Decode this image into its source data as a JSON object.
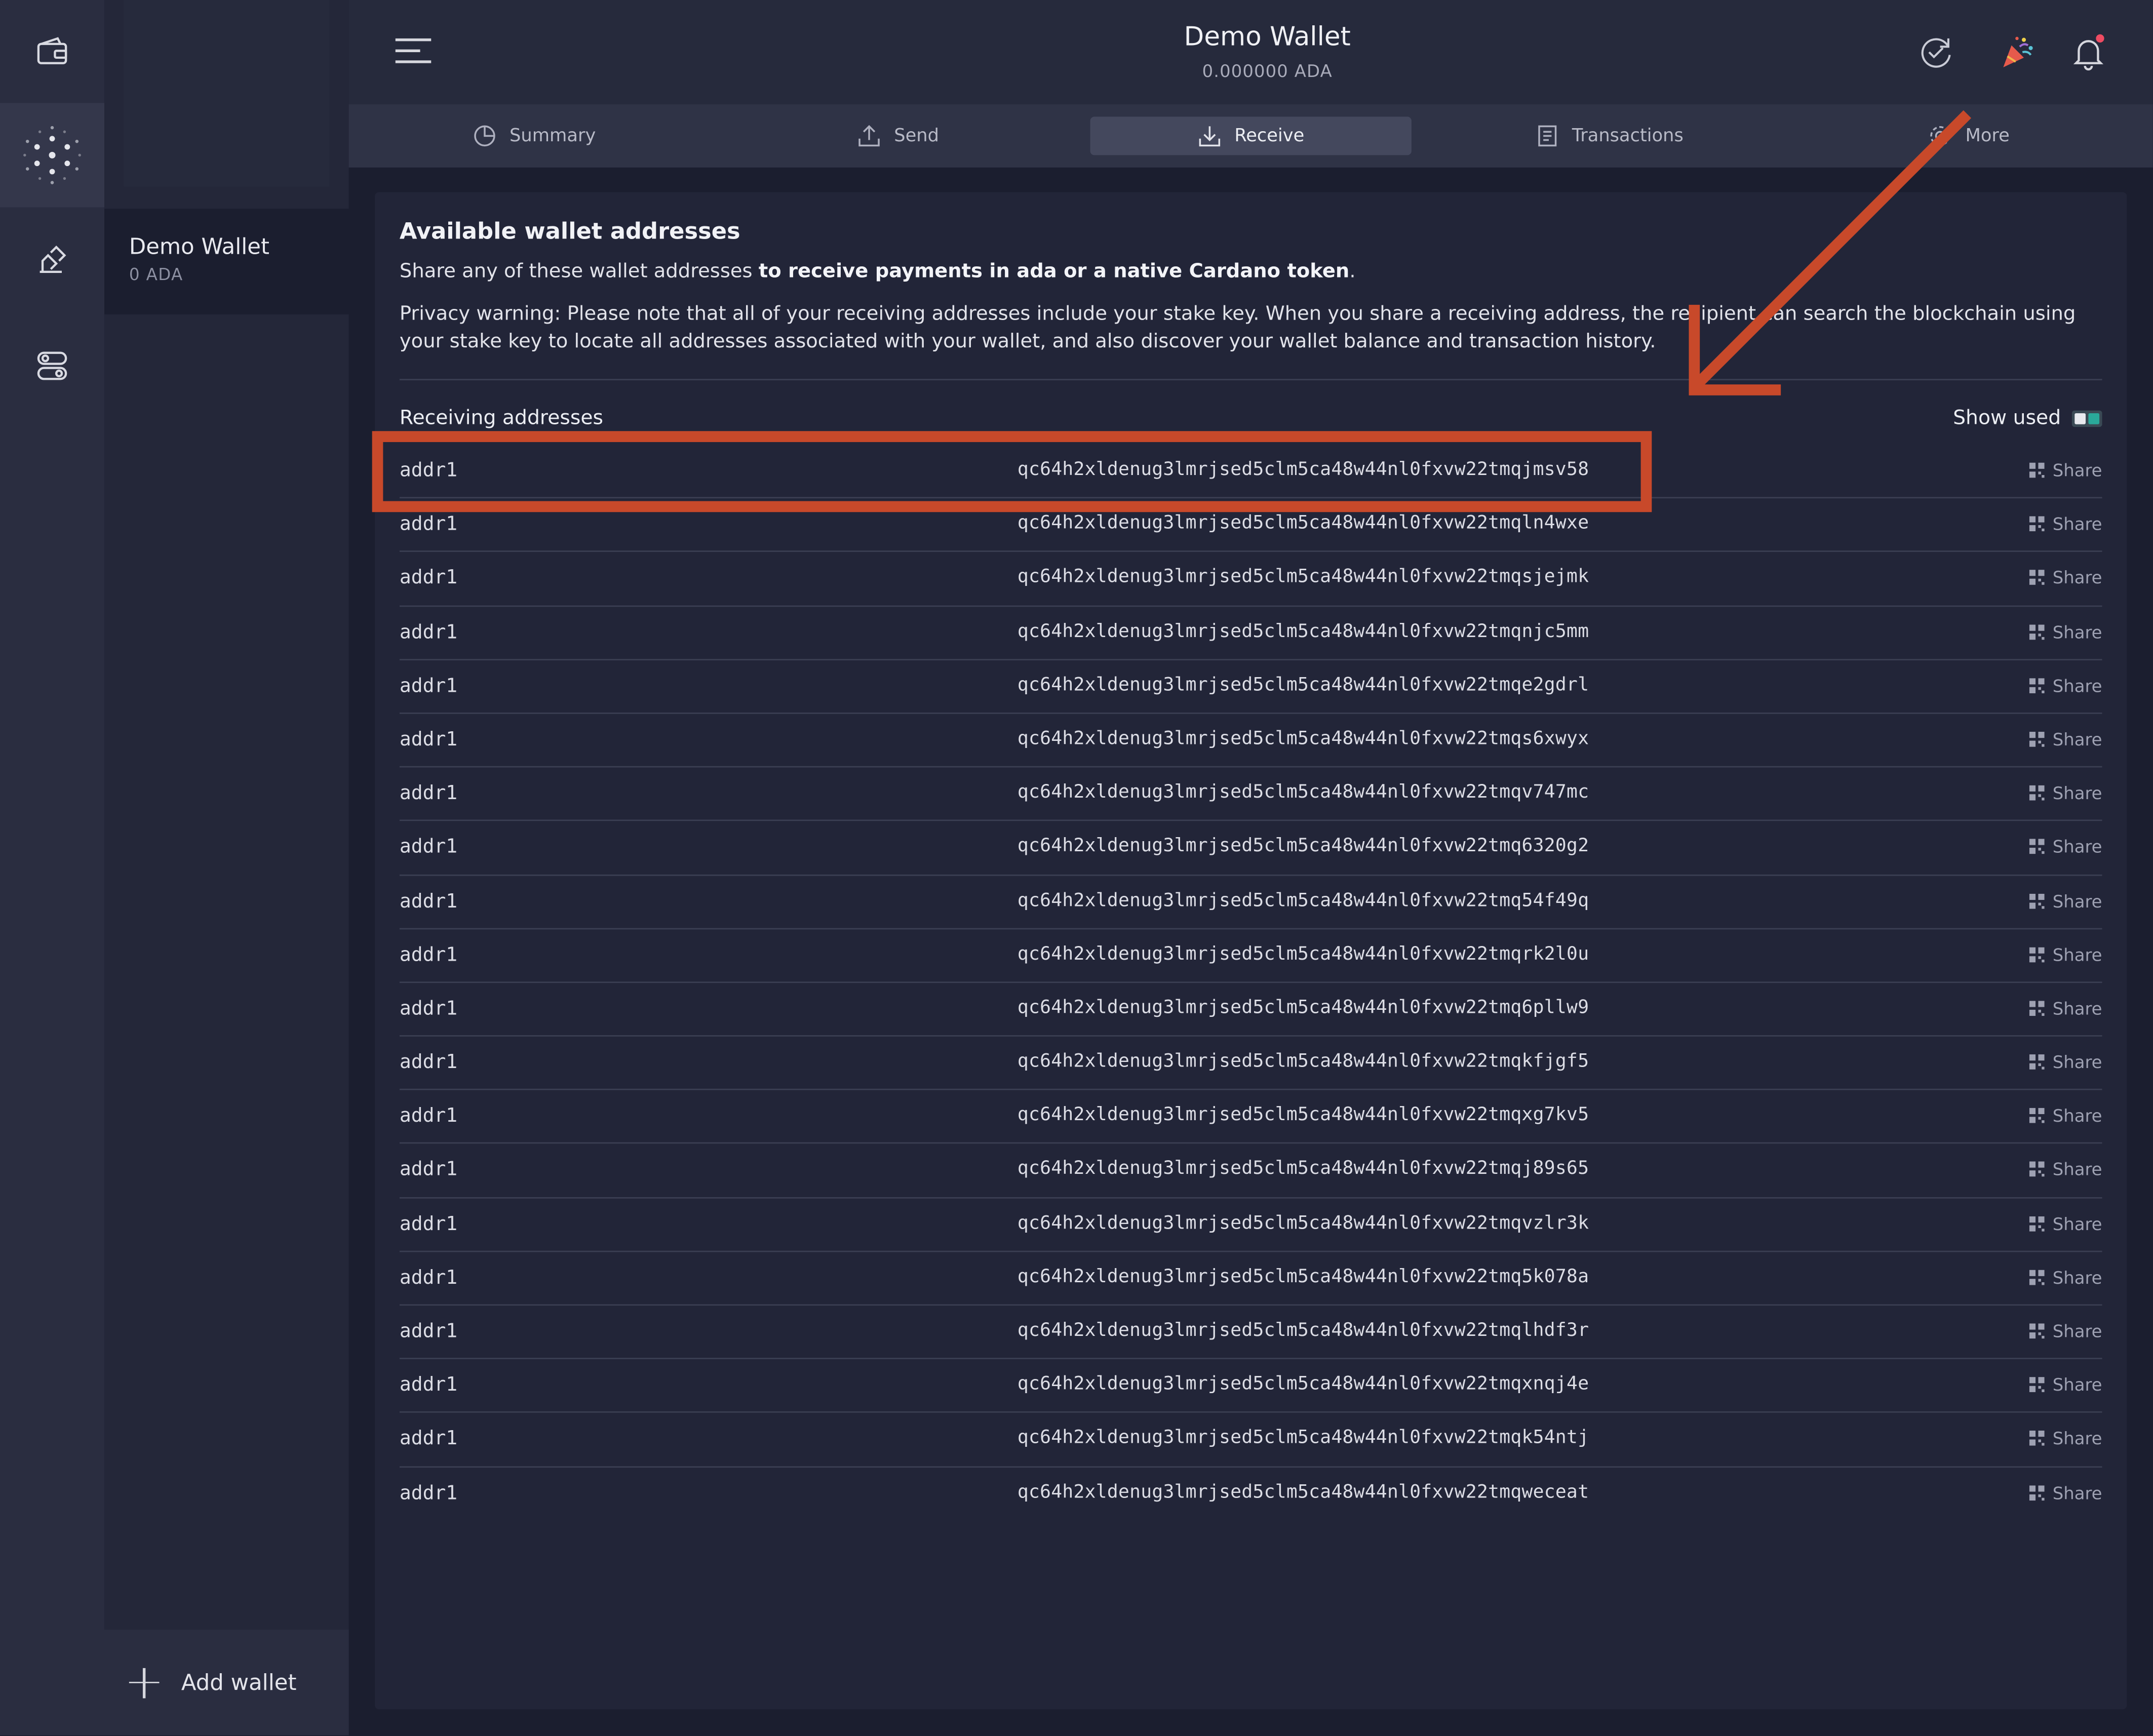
{
  "header": {
    "title": "Demo Wallet",
    "subtitle": "0.000000 ADA"
  },
  "sidebar": {
    "wallet_name": "Demo Wallet",
    "wallet_balance": "0 ADA",
    "add_wallet_label": "Add wallet"
  },
  "tabs": [
    {
      "label": "Summary",
      "icon": "summary-icon"
    },
    {
      "label": "Send",
      "icon": "send-icon"
    },
    {
      "label": "Receive",
      "icon": "receive-icon"
    },
    {
      "label": "Transactions",
      "icon": "transactions-icon"
    },
    {
      "label": "More",
      "icon": "gear-icon"
    }
  ],
  "main": {
    "title": "Available wallet addresses",
    "desc_plain": "Share any of these wallet addresses ",
    "desc_bold": "to receive payments in ada or a native Cardano token",
    "desc_end": ".",
    "privacy": "Privacy warning: Please note that all of your receiving addresses include your stake key. When you share a receiving address, the recipient can search the blockchain using your stake key to locate all addresses associated with your wallet, and also discover your wallet balance and transaction history.",
    "receiving_label": "Receiving addresses",
    "show_used_label": "Show used",
    "share_label": "Share",
    "addresses": [
      {
        "prefix": "addr1",
        "address": "qc64h2xldenug3lmrjsed5clm5ca48w44nl0fxvw22tmqjmsv58"
      },
      {
        "prefix": "addr1",
        "address": "qc64h2xldenug3lmrjsed5clm5ca48w44nl0fxvw22tmqln4wxe"
      },
      {
        "prefix": "addr1",
        "address": "qc64h2xldenug3lmrjsed5clm5ca48w44nl0fxvw22tmqsjejmk"
      },
      {
        "prefix": "addr1",
        "address": "qc64h2xldenug3lmrjsed5clm5ca48w44nl0fxvw22tmqnjc5mm"
      },
      {
        "prefix": "addr1",
        "address": "qc64h2xldenug3lmrjsed5clm5ca48w44nl0fxvw22tmqe2gdrl"
      },
      {
        "prefix": "addr1",
        "address": "qc64h2xldenug3lmrjsed5clm5ca48w44nl0fxvw22tmqs6xwyx"
      },
      {
        "prefix": "addr1",
        "address": "qc64h2xldenug3lmrjsed5clm5ca48w44nl0fxvw22tmqv747mc"
      },
      {
        "prefix": "addr1",
        "address": "qc64h2xldenug3lmrjsed5clm5ca48w44nl0fxvw22tmq6320g2"
      },
      {
        "prefix": "addr1",
        "address": "qc64h2xldenug3lmrjsed5clm5ca48w44nl0fxvw22tmq54f49q"
      },
      {
        "prefix": "addr1",
        "address": "qc64h2xldenug3lmrjsed5clm5ca48w44nl0fxvw22tmqrk2l0u"
      },
      {
        "prefix": "addr1",
        "address": "qc64h2xldenug3lmrjsed5clm5ca48w44nl0fxvw22tmq6pllw9"
      },
      {
        "prefix": "addr1",
        "address": "qc64h2xldenug3lmrjsed5clm5ca48w44nl0fxvw22tmqkfjgf5"
      },
      {
        "prefix": "addr1",
        "address": "qc64h2xldenug3lmrjsed5clm5ca48w44nl0fxvw22tmqxg7kv5"
      },
      {
        "prefix": "addr1",
        "address": "qc64h2xldenug3lmrjsed5clm5ca48w44nl0fxvw22tmqj89s65"
      },
      {
        "prefix": "addr1",
        "address": "qc64h2xldenug3lmrjsed5clm5ca48w44nl0fxvw22tmqvzlr3k"
      },
      {
        "prefix": "addr1",
        "address": "qc64h2xldenug3lmrjsed5clm5ca48w44nl0fxvw22tmq5k078a"
      },
      {
        "prefix": "addr1",
        "address": "qc64h2xldenug3lmrjsed5clm5ca48w44nl0fxvw22tmqlhdf3r"
      },
      {
        "prefix": "addr1",
        "address": "qc64h2xldenug3lmrjsed5clm5ca48w44nl0fxvw22tmqxnqj4e"
      },
      {
        "prefix": "addr1",
        "address": "qc64h2xldenug3lmrjsed5clm5ca48w44nl0fxvw22tmqk54ntj"
      },
      {
        "prefix": "addr1",
        "address": "qc64h2xldenug3lmrjsed5clm5ca48w44nl0fxvw22tmqweceat"
      }
    ]
  },
  "icons": {
    "rail": [
      "wallet-icon",
      "staking-icon",
      "voting-icon",
      "settings-toggle-icon"
    ],
    "header_right": [
      "sync-icon",
      "party-icon",
      "bell-icon"
    ]
  },
  "colors": {
    "annotation": "#c8492a",
    "accent_toggle": "#2aa89a",
    "notification_dot": "#ef4b62"
  }
}
